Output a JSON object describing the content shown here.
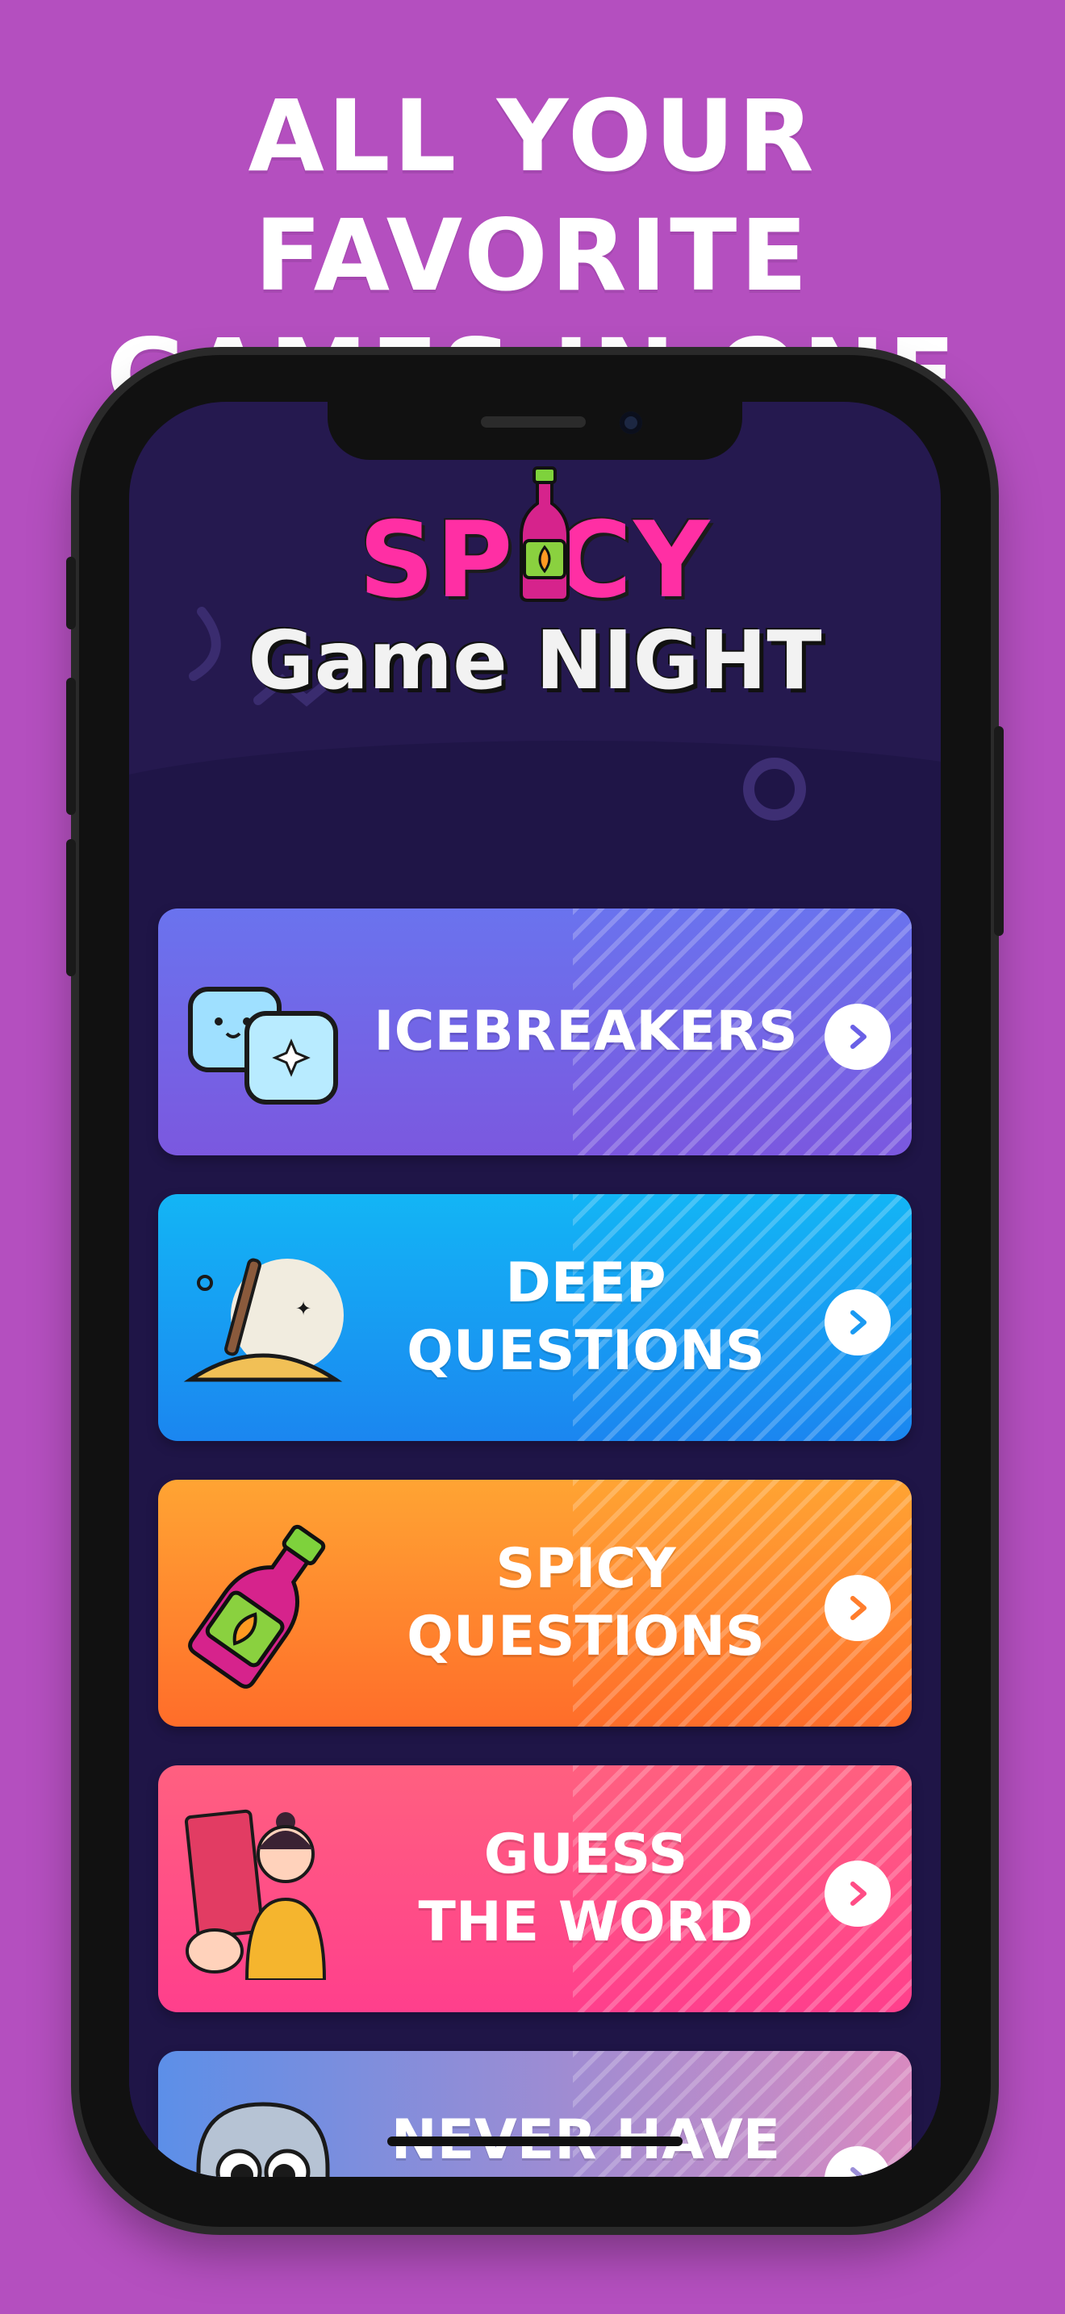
{
  "headline": {
    "line1": "ALL YOUR FAVORITE",
    "line2": "GAMES IN ONE APP"
  },
  "logo": {
    "word1": "SPICY",
    "word2": "Game NIGHT"
  },
  "colors": {
    "background": "#b44fbf",
    "screen": "#25194f",
    "icebreakers": [
      "#6a73ee",
      "#7b58df"
    ],
    "deep_questions": [
      "#13b5f5",
      "#1b86f0"
    ],
    "spicy_questions": [
      "#ffa433",
      "#ff6d2a"
    ],
    "guess_word": [
      "#ff6080",
      "#ff3f8c"
    ],
    "never_have_i_ever": [
      "#5c8fe8",
      "#d88ac0"
    ]
  },
  "games": [
    {
      "label": "ICEBREAKERS",
      "icon": "ice-cubes-icon"
    },
    {
      "label": "DEEP\nQUESTIONS",
      "icon": "shovel-moon-icon"
    },
    {
      "label": "SPICY\nQUESTIONS",
      "icon": "hot-sauce-bottle-icon"
    },
    {
      "label": "GUESS\nTHE WORD",
      "icon": "woman-card-icon"
    },
    {
      "label": "NEVER HAVE\nI EVER",
      "icon": "ghost-face-icon"
    }
  ]
}
